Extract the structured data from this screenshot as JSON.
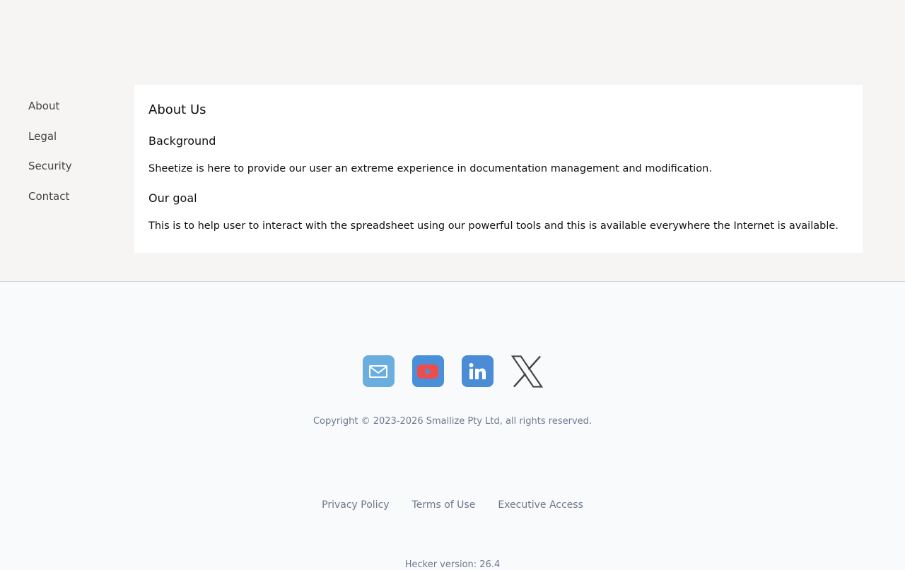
{
  "sidebar": {
    "items": [
      {
        "label": "About"
      },
      {
        "label": "Legal"
      },
      {
        "label": "Security"
      },
      {
        "label": "Contact"
      }
    ]
  },
  "content": {
    "title": "About Us",
    "sections": [
      {
        "heading": "Background",
        "body": "Sheetize is here to provide our user an extreme experience in documentation management and modification."
      },
      {
        "heading": "Our goal",
        "body": "This is to help user to interact with the spreadsheet using our powerful tools and this is available everywhere the Internet is available."
      }
    ]
  },
  "footer": {
    "social": [
      {
        "icon": "mail-icon"
      },
      {
        "icon": "youtube-icon"
      },
      {
        "icon": "linkedin-icon"
      },
      {
        "icon": "x-icon"
      }
    ],
    "copyright": "Copyright © 2023-2026 Smallize Pty Ltd, all rights reserved.",
    "links": [
      {
        "label": "Privacy Policy"
      },
      {
        "label": "Terms of Use"
      },
      {
        "label": "Executive Access"
      }
    ],
    "version": "Hecker version: 26.4"
  }
}
